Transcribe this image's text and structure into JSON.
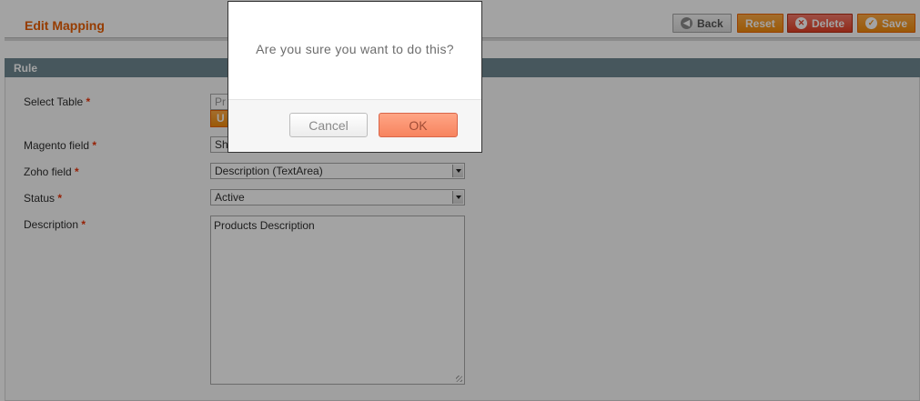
{
  "header": {
    "title": "Edit Mapping",
    "buttons": {
      "back": "Back",
      "reset": "Reset",
      "delete": "Delete",
      "save": "Save"
    }
  },
  "section": {
    "title": "Rule",
    "fields": {
      "select_table": {
        "label": "Select Table",
        "value": "Pr",
        "action": "U"
      },
      "magento_field": {
        "label": "Magento field",
        "value": "Sh"
      },
      "zoho_field": {
        "label": "Zoho field",
        "value": "Description (TextArea)"
      },
      "status": {
        "label": "Status",
        "value": "Active"
      },
      "description": {
        "label": "Description",
        "value": "Products Description"
      }
    },
    "required_marker": "*"
  },
  "dialog": {
    "message": "Are you sure you want to do this?",
    "cancel_label": "Cancel",
    "ok_label": "OK"
  },
  "icons": {
    "back": "back-arrow-icon",
    "delete": "delete-x-icon",
    "save": "checkmark-icon"
  },
  "colors": {
    "accent_orange": "#eb5e00",
    "button_orange": "#f28c0d",
    "section_header": "#6f8992",
    "dialog_ok": "#f7845f"
  }
}
